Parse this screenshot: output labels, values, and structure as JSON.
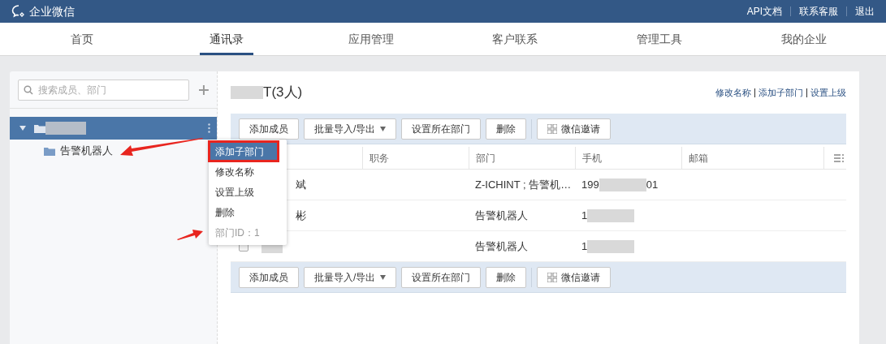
{
  "top_bar": {
    "logo": "企业微信",
    "links": [
      "API文档",
      "联系客服",
      "退出"
    ]
  },
  "nav_tabs": [
    {
      "label": "首页",
      "selected": false
    },
    {
      "label": "通讯录",
      "selected": true
    },
    {
      "label": "应用管理",
      "selected": false
    },
    {
      "label": "客户联系",
      "selected": false
    },
    {
      "label": "管理工具",
      "selected": false
    },
    {
      "label": "我的企业",
      "selected": false
    }
  ],
  "sidebar": {
    "search": {
      "placeholder": "搜索成员、部门"
    },
    "tree": [
      {
        "expanded": true,
        "selected": true,
        "children": [
          {
            "label": "告警机器人"
          }
        ]
      }
    ]
  },
  "context_menu": [
    {
      "kind": "action",
      "label": "添加子部门",
      "selected": true
    },
    {
      "kind": "action",
      "label": "修改名称",
      "selected": false
    },
    {
      "kind": "action",
      "label": "设置上级",
      "selected": false
    },
    {
      "kind": "action",
      "label": "删除",
      "selected": false
    },
    {
      "kind": "info",
      "label": "部门ID：1"
    }
  ],
  "main": {
    "title": "T(3人)",
    "header_links": [
      "修改名称",
      "添加子部门",
      "设置上级"
    ],
    "toolbars": [
      {
        "buttons": [
          {
            "kind": "plain",
            "label": "添加成员"
          },
          {
            "kind": "dropdown",
            "label": "批量导入/导出"
          },
          {
            "kind": "plain",
            "label": "设置所在部门"
          },
          {
            "kind": "plain",
            "label": "删除"
          },
          {
            "kind": "qr",
            "label": "微信邀请"
          }
        ]
      },
      {
        "buttons": [
          {
            "kind": "plain",
            "label": "添加成员"
          },
          {
            "kind": "dropdown",
            "label": "批量导入/导出"
          },
          {
            "kind": "plain",
            "label": "设置所在部门"
          },
          {
            "kind": "plain",
            "label": "删除"
          },
          {
            "kind": "qr",
            "label": "微信邀请"
          }
        ]
      }
    ],
    "columns": [
      "职务",
      "部门",
      "手机",
      "邮箱"
    ],
    "rows": [
      {
        "name": "斌",
        "department": "Z-ICHINT ; 告警机…",
        "phone_start": "199",
        "phone_end": "01"
      },
      {
        "name": "彬",
        "department": "告警机器人",
        "phone_start": "1"
      },
      {
        "checked": false,
        "department": "告警机器人",
        "phone_start": "1"
      }
    ]
  }
}
